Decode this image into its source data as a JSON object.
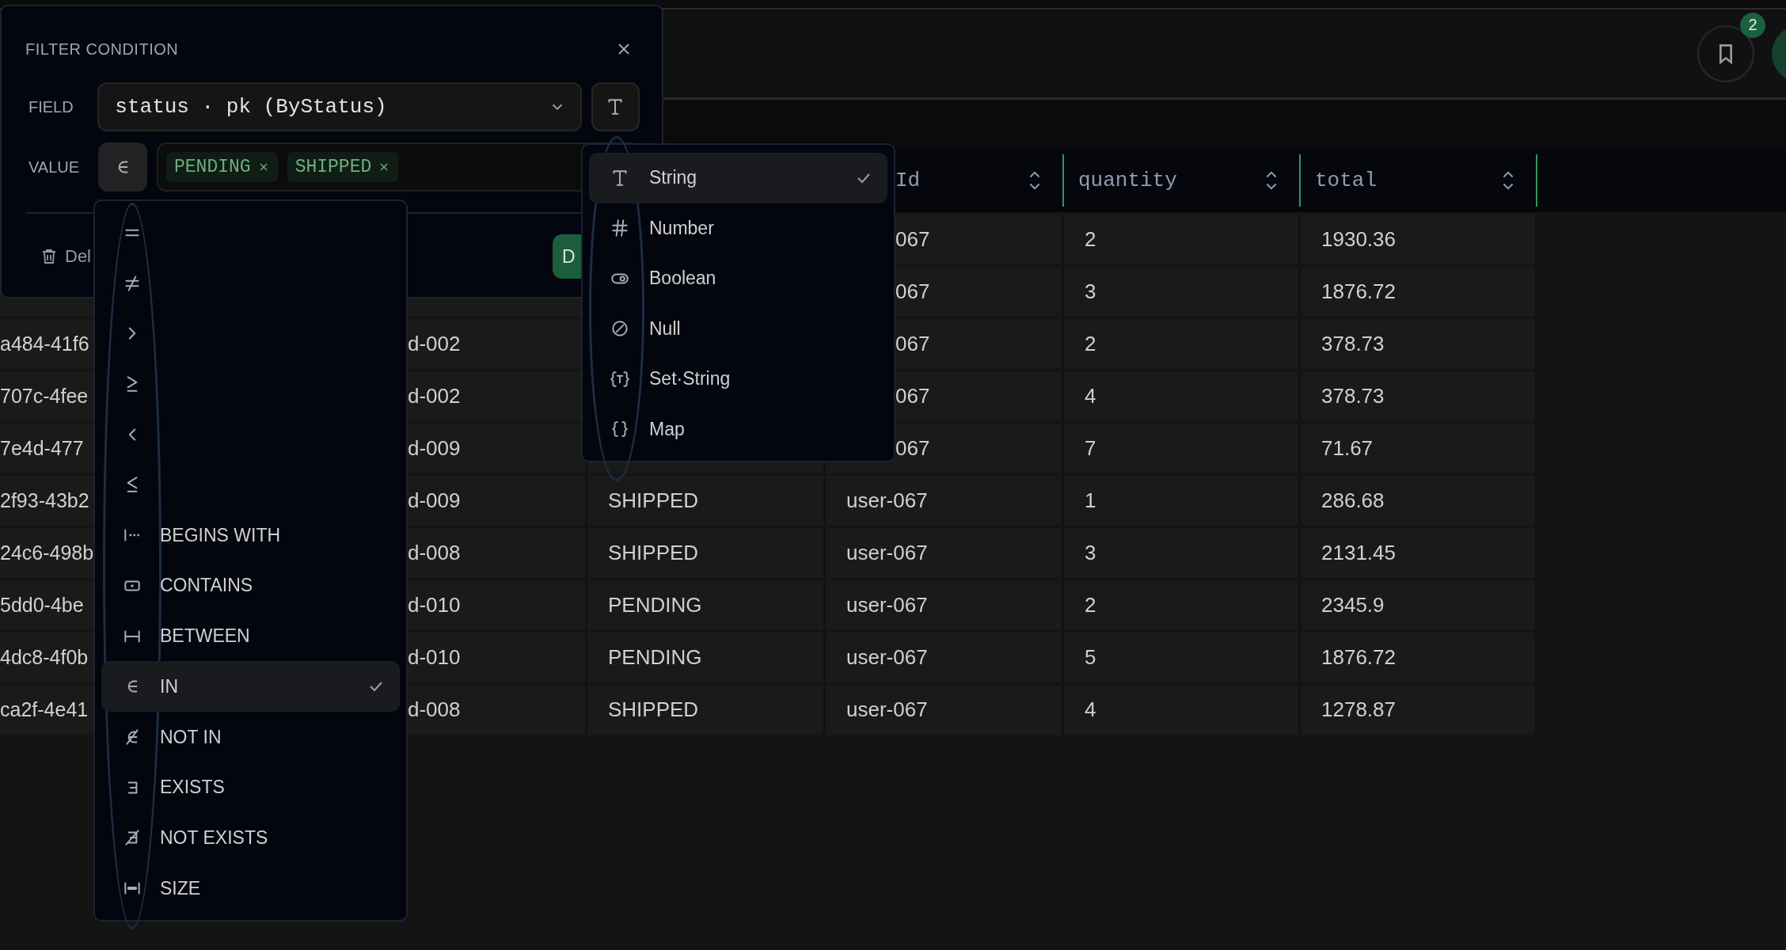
{
  "topbar": {
    "bookmark_badge": "2"
  },
  "filter_panel": {
    "title": "FILTER CONDITION",
    "field_label": "FIELD",
    "field_value": "status · pk (ByStatus)",
    "value_label": "VALUE",
    "chips": [
      {
        "label": "PENDING"
      },
      {
        "label": "SHIPPED"
      }
    ],
    "delete_label": "Del",
    "apply_label": "D"
  },
  "operator_menu": [
    {
      "kind": "eq",
      "selected": false
    },
    {
      "kind": "ne",
      "selected": false
    },
    {
      "kind": "gt",
      "selected": false
    },
    {
      "kind": "ge",
      "selected": false
    },
    {
      "kind": "lt",
      "selected": false
    },
    {
      "kind": "le",
      "selected": false
    },
    {
      "kind": "begins",
      "label": "BEGINS WITH",
      "selected": false
    },
    {
      "kind": "contains",
      "label": "CONTAINS",
      "selected": false
    },
    {
      "kind": "between",
      "label": "BETWEEN",
      "selected": false
    },
    {
      "kind": "in",
      "label": "IN",
      "selected": true
    },
    {
      "kind": "notin",
      "label": "NOT IN",
      "selected": false
    },
    {
      "kind": "exists",
      "label": "EXISTS",
      "selected": false
    },
    {
      "kind": "notexists",
      "label": "NOT EXISTS",
      "selected": false
    },
    {
      "kind": "size",
      "label": "SIZE",
      "selected": false
    }
  ],
  "type_menu": [
    {
      "kind": "string",
      "label": "String",
      "selected": true
    },
    {
      "kind": "number",
      "label": "Number",
      "selected": false
    },
    {
      "kind": "boolean",
      "label": "Boolean",
      "selected": false
    },
    {
      "kind": "null",
      "label": "Null",
      "selected": false
    },
    {
      "kind": "set",
      "label": "Set·String",
      "selected": false
    },
    {
      "kind": "map",
      "label": "Map",
      "selected": false
    }
  ],
  "table": {
    "columns": [
      "Id",
      "quantity",
      "total"
    ],
    "rows": [
      {
        "id": "067",
        "quantity": "2",
        "total": "1930.36"
      },
      {
        "id": "067",
        "quantity": "3",
        "total": "1876.72"
      },
      {
        "column_1": "a484-41f6",
        "column_2": "d-002",
        "id": "067",
        "quantity": "2",
        "total": "378.73"
      },
      {
        "column_1": "707c-4fee",
        "column_2": "d-002",
        "id": "067",
        "quantity": "4",
        "total": "378.73"
      },
      {
        "column_1": "7e4d-477",
        "column_2": "d-009",
        "id": "067",
        "quantity": "7",
        "total": "71.67"
      },
      {
        "column_1": "2f93-43b2",
        "column_2": "d-009",
        "column_3": "SHIPPED",
        "id": "user-067",
        "quantity": "1",
        "total": "286.68"
      },
      {
        "column_1": "24c6-498b",
        "column_2": "d-008",
        "column_3": "SHIPPED",
        "id": "user-067",
        "quantity": "3",
        "total": "2131.45"
      },
      {
        "column_1": "5dd0-4be",
        "column_2": "d-010",
        "column_3": "PENDING",
        "id": "user-067",
        "quantity": "2",
        "total": "2345.9"
      },
      {
        "column_1": "4dc8-4f0b",
        "column_2": "d-010",
        "column_3": "PENDING",
        "id": "user-067",
        "quantity": "5",
        "total": "1876.72"
      },
      {
        "column_1": "ca2f-4e41",
        "column_2": "d-008",
        "column_3": "SHIPPED",
        "id": "user-067",
        "quantity": "4",
        "total": "1278.87"
      }
    ]
  }
}
